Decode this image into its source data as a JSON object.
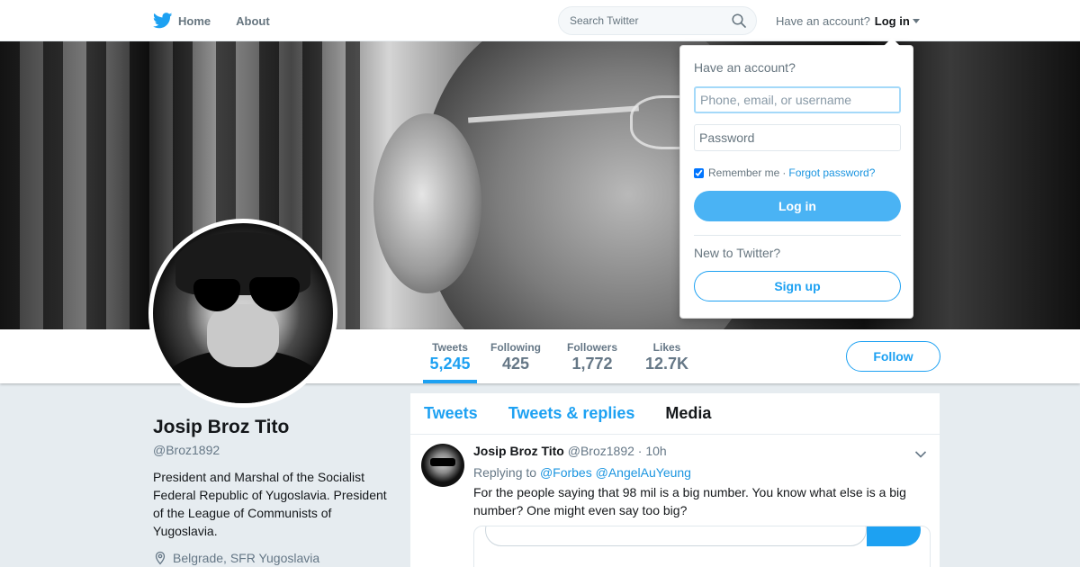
{
  "nav": {
    "home_label": "Home",
    "about_label": "About",
    "search_placeholder": "Search Twitter",
    "have_account": "Have an account?",
    "login_label": "Log in"
  },
  "login_dropdown": {
    "title": "Have an account?",
    "username_placeholder": "Phone, email, or username",
    "password_placeholder": "Password",
    "remember_label": "Remember me",
    "separator": "·",
    "forgot_label": "Forgot password?",
    "login_button": "Log in",
    "new_label": "New to Twitter?",
    "signup_button": "Sign up"
  },
  "stats": [
    {
      "label": "Tweets",
      "value": "5,245",
      "active": true
    },
    {
      "label": "Following",
      "value": "425"
    },
    {
      "label": "Followers",
      "value": "1,772"
    },
    {
      "label": "Likes",
      "value": "12.7K"
    }
  ],
  "follow_button": "Follow",
  "profile": {
    "name": "Josip Broz Tito",
    "handle": "@Broz1892",
    "bio": "President and Marshal of the Socialist Federal Republic of Yugoslavia. President of the League of Communists of Yugoslavia.",
    "location": "Belgrade, SFR Yugoslavia"
  },
  "timeline": {
    "tabs": [
      "Tweets",
      "Tweets & replies",
      "Media"
    ],
    "current_tab": "Media"
  },
  "tweet": {
    "name": "Josip Broz Tito",
    "handle": "@Broz1892",
    "separator": "·",
    "time": "10h",
    "replying_to_label": "Replying to",
    "mentions": [
      "@Forbes",
      "@AngelAuYeung"
    ],
    "text": "For the people saying that 98 mil is a big number. You know what else is a big number? One might even say too big?"
  },
  "colors": {
    "brand_blue": "#1da1f2",
    "link_blue": "#1b95e0",
    "muted_text": "#657786",
    "page_bg": "#e6ecf0"
  }
}
